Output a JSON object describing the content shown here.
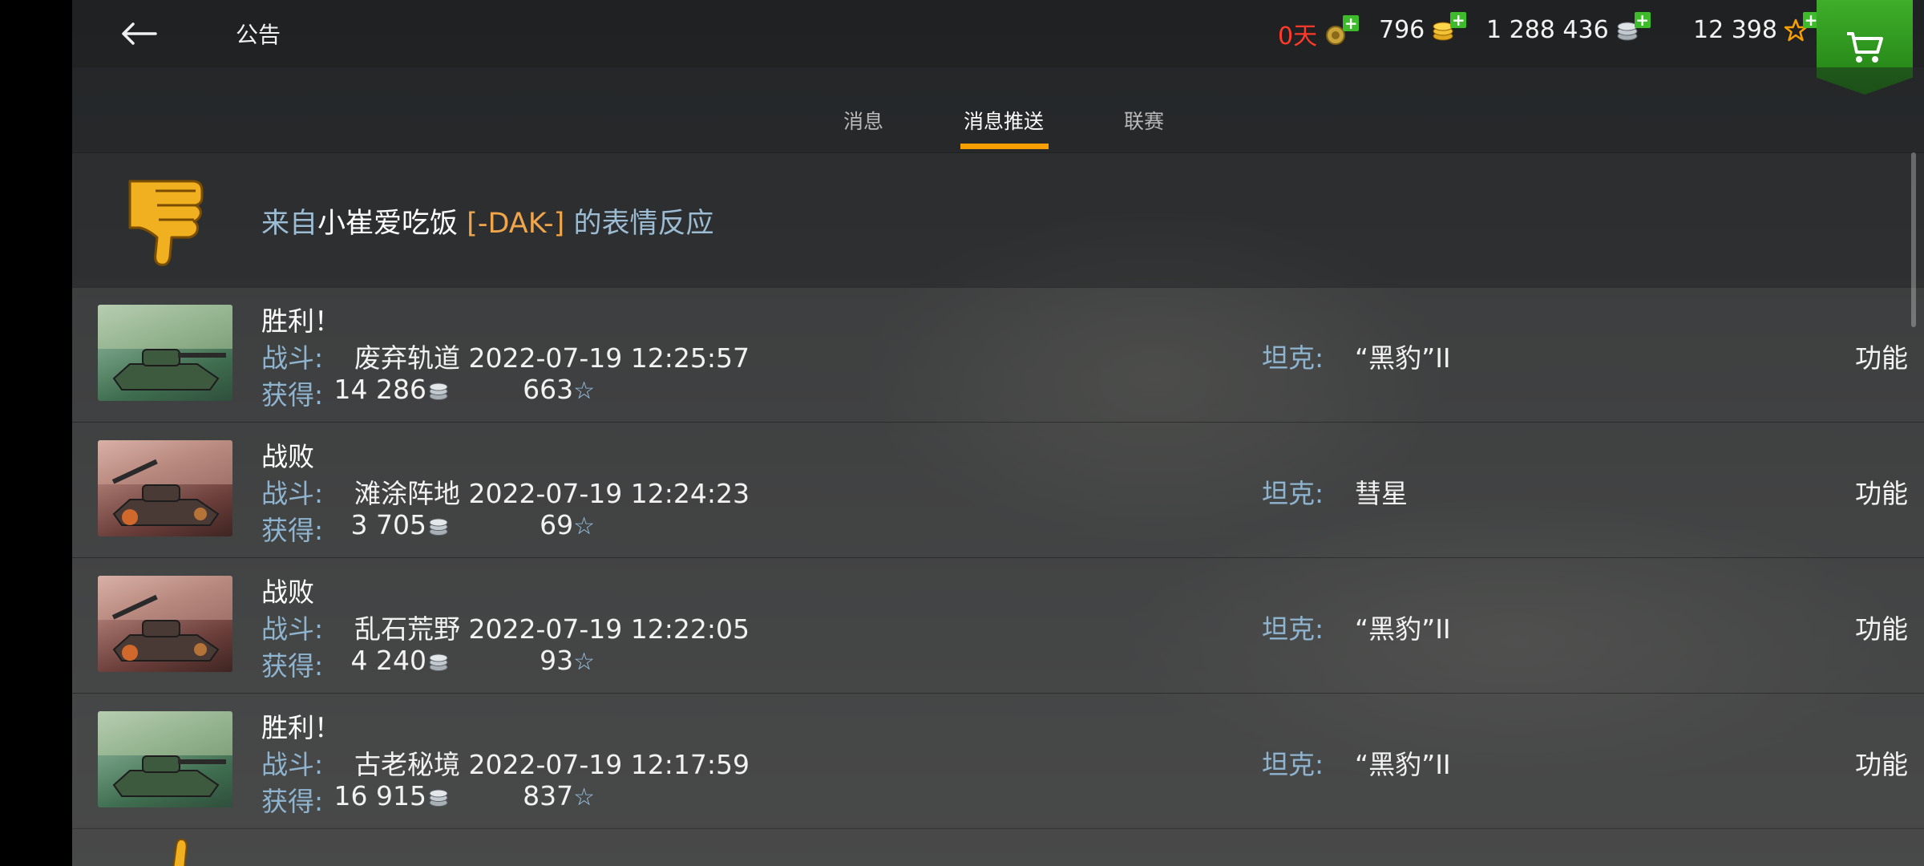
{
  "header": {
    "title": "公告",
    "premium_days": "0天",
    "gold": "796",
    "silver": "1 288 436",
    "free_xp": "12 398"
  },
  "tabs": [
    {
      "label": "消息",
      "active": false
    },
    {
      "label": "消息推送",
      "active": true
    },
    {
      "label": "联赛",
      "active": false
    }
  ],
  "reaction": {
    "prefix": "来自",
    "username": "小崔爱吃饭",
    "clan": "[-DAK-]",
    "suffix": "的表情反应"
  },
  "labels": {
    "battle": "战斗:",
    "earned": "获得:",
    "tank": "坦克:",
    "function": "功能"
  },
  "battles": [
    {
      "result": "胜利！",
      "outcome": "win",
      "map_time": "废弃轨道 2022-07-19 12:25:57",
      "silver": "14 286",
      "xp": "663",
      "tank": "“黑豹”II"
    },
    {
      "result": "战败",
      "outcome": "loss",
      "map_time": "滩涂阵地 2022-07-19 12:24:23",
      "silver": "3 705",
      "xp": "69",
      "tank": "彗星"
    },
    {
      "result": "战败",
      "outcome": "loss",
      "map_time": "乱石荒野 2022-07-19 12:22:05",
      "silver": "4 240",
      "xp": "93",
      "tank": "“黑豹”II"
    },
    {
      "result": "胜利！",
      "outcome": "win",
      "map_time": "古老秘境 2022-07-19 12:17:59",
      "silver": "16 915",
      "xp": "837",
      "tank": "“黑豹”II"
    }
  ],
  "colors": {
    "accent": "#f5a000",
    "label_blue": "#8fb4cf",
    "premium_red": "#ff3a2a",
    "shop_green": "#3fae2a",
    "clan_orange": "#f0a54a"
  }
}
